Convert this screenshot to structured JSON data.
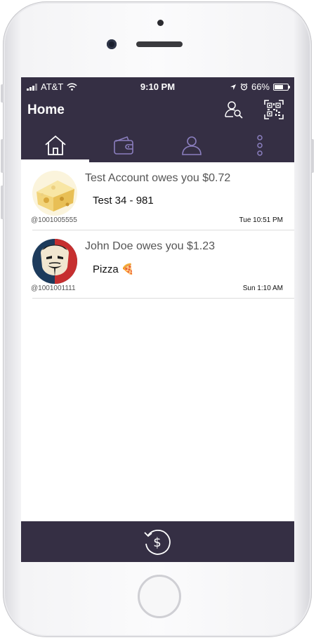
{
  "status_bar": {
    "carrier": "AT&T",
    "time": "9:10 PM",
    "battery_percent": "66%",
    "battery_level": 0.66
  },
  "header": {
    "title": "Home",
    "icons": [
      "user-search-icon",
      "qr-code-icon"
    ]
  },
  "tabs": [
    {
      "name": "home",
      "icon": "home-icon",
      "active": true
    },
    {
      "name": "wallet",
      "icon": "wallet-icon",
      "active": false
    },
    {
      "name": "contacts",
      "icon": "person-icon",
      "active": false
    },
    {
      "name": "more",
      "icon": "more-vertical-icon",
      "active": false
    }
  ],
  "transactions": [
    {
      "headline": "Test Account owes you $0.72",
      "memo": "Test 34 - 981",
      "user_id": "@1001005555",
      "timestamp": "Tue 10:51 PM",
      "avatar": "cheese-avatar"
    },
    {
      "headline": "John Doe owes you $1.23",
      "memo": "Pizza 🍕",
      "user_id": "@1001001111",
      "timestamp": "Sun 1:10 AM",
      "avatar": "mask-avatar"
    }
  ],
  "bottom_bar": {
    "action_icon": "history-dollar-icon"
  },
  "colors": {
    "header_bg": "#352f44",
    "icon_accent": "#8b7fbf",
    "text_muted": "#555555"
  }
}
